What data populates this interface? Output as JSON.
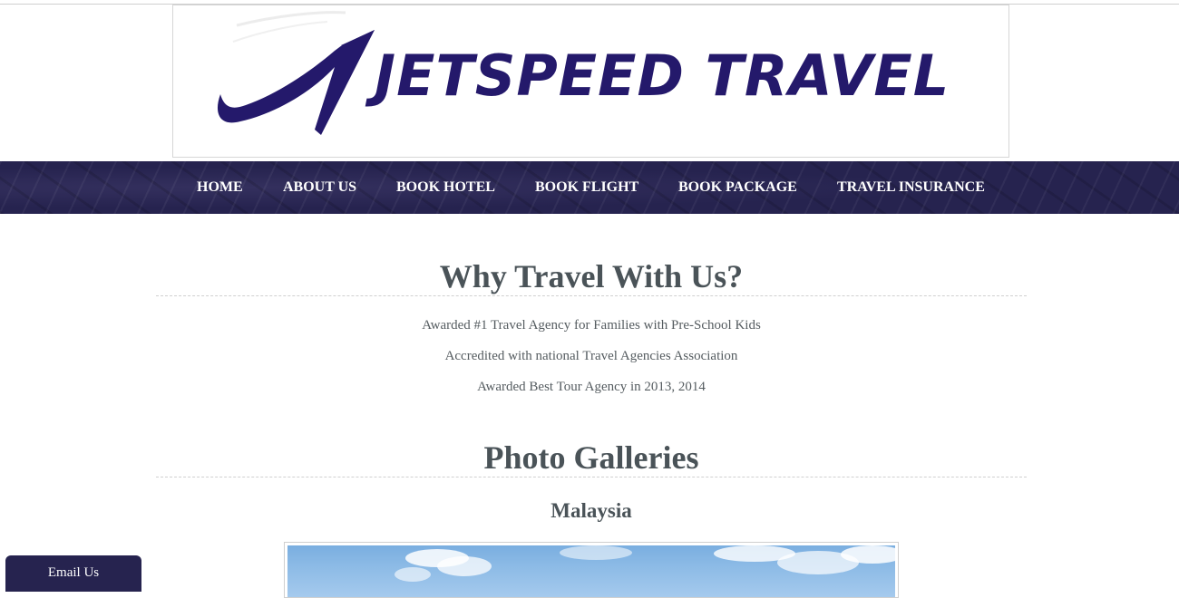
{
  "brand": {
    "name": "JETSPEED TRAVEL",
    "logo_icon": "jet-swoosh-icon",
    "color": "#24196b"
  },
  "nav": {
    "items": [
      {
        "label": "HOME"
      },
      {
        "label": "ABOUT US"
      },
      {
        "label": "BOOK HOTEL"
      },
      {
        "label": "BOOK FLIGHT"
      },
      {
        "label": "BOOK PACKAGE"
      },
      {
        "label": "TRAVEL INSURANCE"
      }
    ],
    "background_color": "#26234f"
  },
  "why": {
    "title": "Why Travel With Us?",
    "features": [
      "Awarded #1 Travel Agency for Families with Pre-School Kids",
      "Accredited with national Travel Agencies Association",
      "Awarded Best Tour Agency in 2013, 2014"
    ]
  },
  "galleries": {
    "title": "Photo Galleries",
    "items": [
      {
        "name": "Malaysia",
        "image": "malaysia-sky-photo"
      }
    ]
  },
  "email_tab": {
    "label": "Email Us"
  }
}
